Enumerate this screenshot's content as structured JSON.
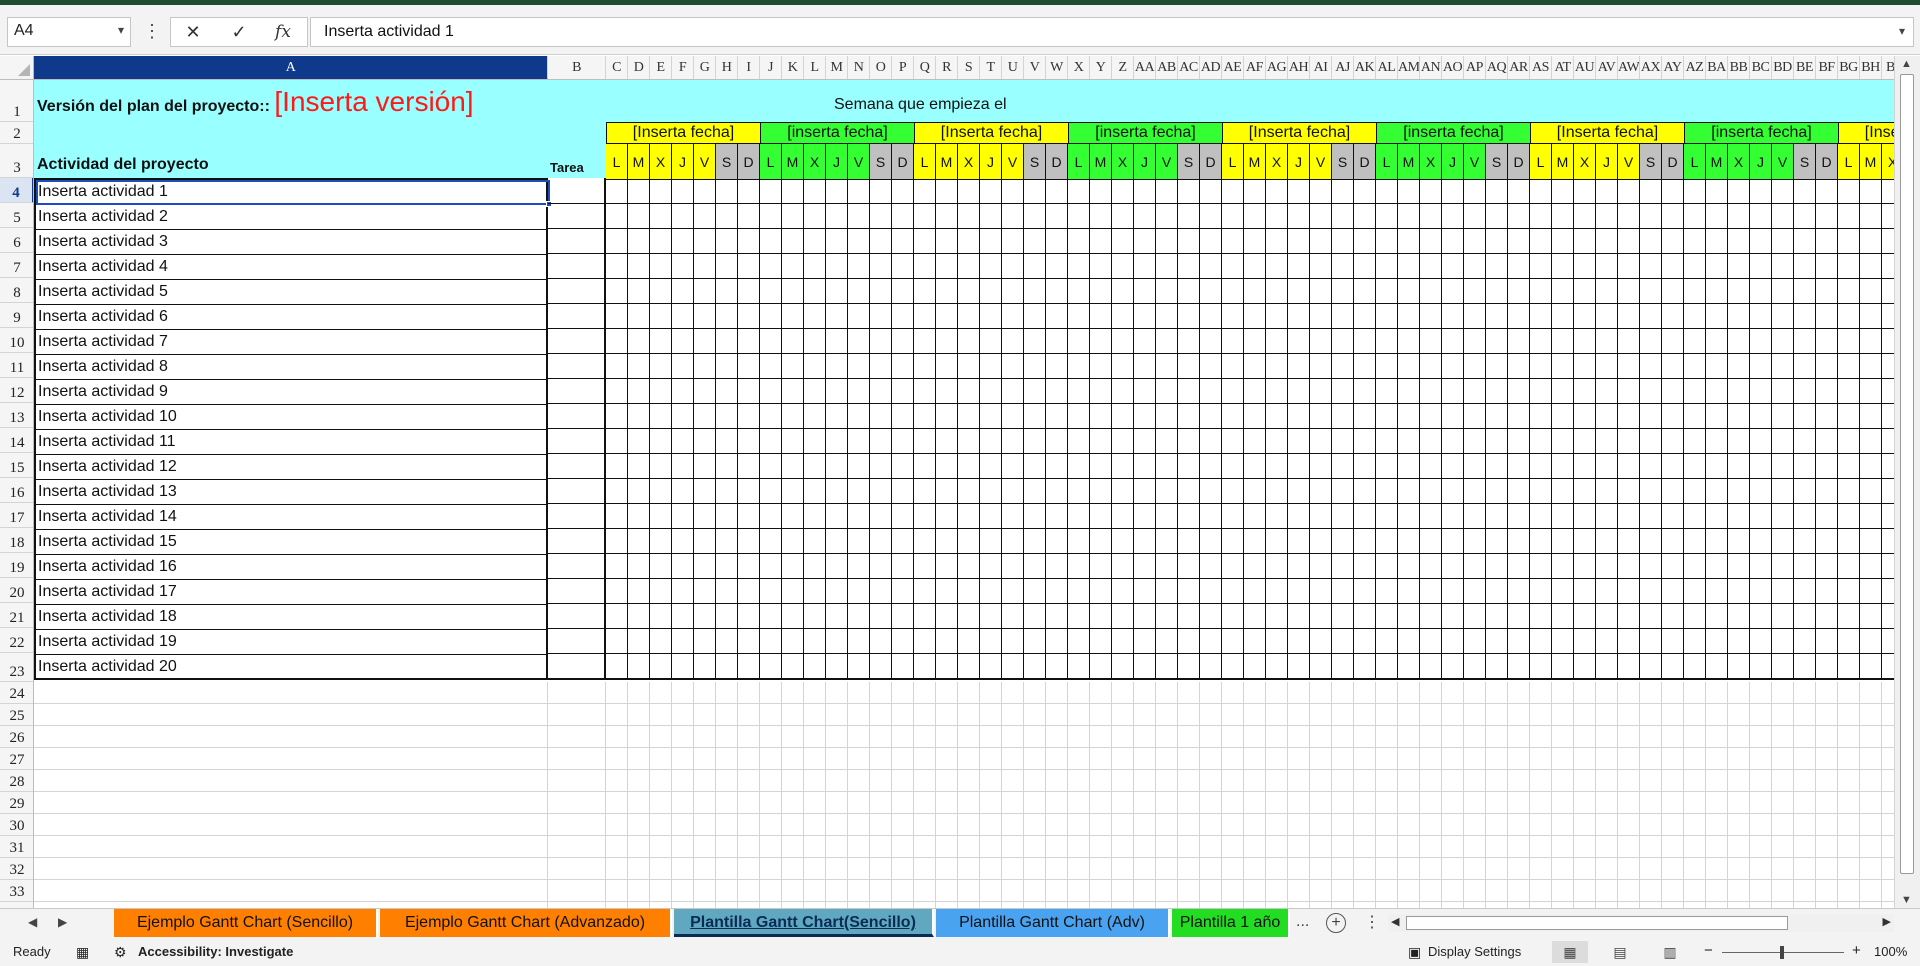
{
  "formula_bar": {
    "name_box": "A4",
    "cancel_icon": "✕",
    "enter_icon": "✓",
    "fx_label": "fx",
    "formula": "Inserta actividad 1"
  },
  "columns": [
    {
      "label": "A",
      "w": 0
    },
    {
      "label": "B"
    },
    {
      "label": "C"
    },
    {
      "label": "D"
    },
    {
      "label": "E"
    },
    {
      "label": "F"
    },
    {
      "label": "G"
    },
    {
      "label": "H"
    },
    {
      "label": "I"
    },
    {
      "label": "J"
    },
    {
      "label": "K"
    },
    {
      "label": "L"
    },
    {
      "label": "M"
    },
    {
      "label": "N"
    },
    {
      "label": "O"
    },
    {
      "label": "P"
    },
    {
      "label": "Q"
    },
    {
      "label": "R"
    },
    {
      "label": "S"
    },
    {
      "label": "T"
    },
    {
      "label": "U"
    },
    {
      "label": "V"
    },
    {
      "label": "W"
    },
    {
      "label": "X"
    },
    {
      "label": "Y"
    },
    {
      "label": "Z"
    },
    {
      "label": "AA"
    },
    {
      "label": "AB"
    },
    {
      "label": "AC"
    },
    {
      "label": "AD"
    },
    {
      "label": "AE"
    },
    {
      "label": "AF"
    },
    {
      "label": "AG"
    },
    {
      "label": "AH"
    },
    {
      "label": "AI"
    },
    {
      "label": "AJ"
    },
    {
      "label": "AK"
    },
    {
      "label": "AL"
    },
    {
      "label": "AM"
    },
    {
      "label": "AN"
    },
    {
      "label": "AO"
    },
    {
      "label": "AP"
    },
    {
      "label": "AQ"
    },
    {
      "label": "AR"
    },
    {
      "label": "AS"
    },
    {
      "label": "AT"
    },
    {
      "label": "AU"
    },
    {
      "label": "AV"
    },
    {
      "label": "AW"
    },
    {
      "label": "AX"
    },
    {
      "label": "AY"
    },
    {
      "label": "AZ"
    },
    {
      "label": "BA"
    },
    {
      "label": "BB"
    },
    {
      "label": "BC"
    },
    {
      "label": "BD"
    },
    {
      "label": "BE"
    },
    {
      "label": "BF"
    },
    {
      "label": "BG"
    },
    {
      "label": "BH"
    },
    {
      "label": "BI"
    }
  ],
  "active_column": "A",
  "active_row": "4",
  "rows": [
    "1",
    "2",
    "3",
    "4",
    "5",
    "6",
    "7",
    "8",
    "9",
    "10",
    "11",
    "12",
    "13",
    "14",
    "15",
    "16",
    "17",
    "18",
    "19",
    "20",
    "21",
    "22",
    "23",
    "24",
    "25",
    "26",
    "27",
    "28",
    "29",
    "30",
    "31",
    "32",
    "33"
  ],
  "sheet": {
    "version_label": "Versión del plan del proyecto::",
    "version_value": "[Inserta versión]",
    "week_label": "Semana que empieza el",
    "activity_header": "Actividad del proyecto",
    "task_header": "Tarea",
    "weeks": [
      {
        "label": "[Inserta fecha]",
        "color": "#ffff00"
      },
      {
        "label": "[inserta fecha]",
        "color": "#33ff33"
      },
      {
        "label": "[Inserta fecha]",
        "color": "#ffff00"
      },
      {
        "label": "[inserta fecha]",
        "color": "#33ff33"
      },
      {
        "label": "[Inserta fecha]",
        "color": "#ffff00"
      },
      {
        "label": "[inserta fecha]",
        "color": "#33ff33"
      },
      {
        "label": "[Inserta fecha]",
        "color": "#ffff00"
      },
      {
        "label": "[inserta fecha]",
        "color": "#33ff33"
      },
      {
        "label": "[Inserta fecha]",
        "color": "#ffff00"
      }
    ],
    "days": [
      "L",
      "M",
      "X",
      "J",
      "V",
      "S",
      "D"
    ],
    "weekend_color": "#c0c0c0",
    "header_color": "#99ffff",
    "activities": [
      "Inserta actividad 1",
      "Inserta actividad 2",
      "Inserta actividad 3",
      "Inserta actividad 4",
      "Inserta actividad 5",
      "Inserta actividad 6",
      "Inserta actividad 7",
      "Inserta actividad 8",
      "Inserta actividad 9",
      "Inserta actividad 10",
      "Inserta actividad 11",
      "Inserta actividad 12",
      "Inserta actividad 13",
      "Inserta actividad 14",
      "Inserta actividad 15",
      "Inserta actividad 16",
      "Inserta actividad 17",
      "Inserta actividad 18",
      "Inserta actividad 19",
      "Inserta actividad 20"
    ]
  },
  "tabs": [
    {
      "label": "Ejemplo Gantt Chart (Sencillo)",
      "color": "#ff7f00",
      "text_color": "#111111",
      "active": false
    },
    {
      "label": "Ejemplo Gantt Chart (Advanzado)",
      "color": "#ff7f00",
      "text_color": "#111111",
      "active": false
    },
    {
      "label": "Plantilla Gantt Chart(Sencillo)",
      "color": "#5fa8c0",
      "text_color": "#0b2a55",
      "active": true
    },
    {
      "label": "Plantilla Gantt Chart (Adv)",
      "color": "#4aa3f0",
      "text_color": "#111111",
      "active": false
    },
    {
      "label": "Plantilla 1 año",
      "color": "#22dd22",
      "text_color": "#111111",
      "active": false
    }
  ],
  "tab_more": "...",
  "status": {
    "ready": "Ready",
    "accessibility": "Accessibility: Investigate",
    "display_settings": "Display Settings",
    "zoom": "100%",
    "zoom_out": "−",
    "zoom_in": "+"
  }
}
